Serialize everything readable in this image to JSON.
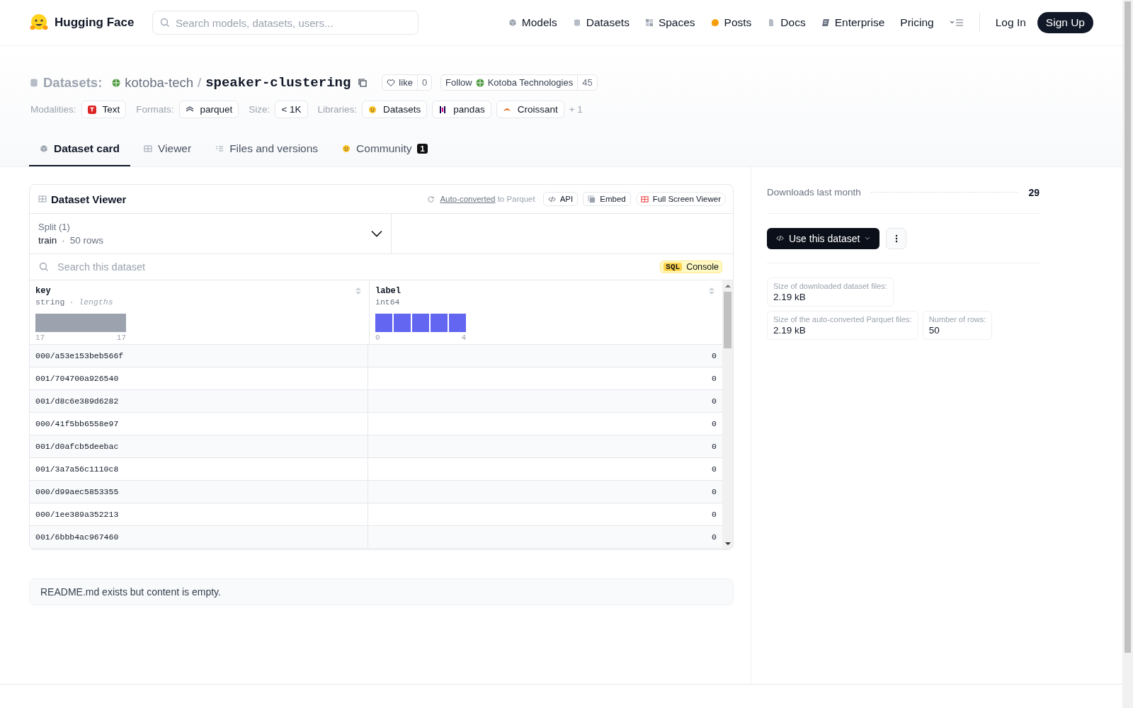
{
  "header": {
    "brand": "Hugging Face",
    "search": {
      "placeholder": "Search models, datasets, users..."
    },
    "nav": [
      {
        "label": "Models"
      },
      {
        "label": "Datasets"
      },
      {
        "label": "Spaces"
      },
      {
        "label": "Posts"
      },
      {
        "label": "Docs"
      },
      {
        "label": "Enterprise"
      },
      {
        "label": "Pricing"
      }
    ],
    "login": "Log In",
    "signup": "Sign Up"
  },
  "repo": {
    "type": "Datasets:",
    "owner": "kotoba-tech",
    "separator": "/",
    "name": "speaker-clustering",
    "like": "like",
    "likes": "0",
    "follow": "Follow",
    "org": "Kotoba Technologies",
    "followers": "45"
  },
  "tags": [
    {
      "label": "Modalities:",
      "items": [
        {
          "text": "Text"
        }
      ]
    },
    {
      "label": "Formats:",
      "items": [
        {
          "text": "parquet"
        }
      ]
    },
    {
      "label": "Size:",
      "items": [
        {
          "text": "< 1K"
        }
      ]
    },
    {
      "label": "Libraries:",
      "items": [
        {
          "text": "Datasets"
        },
        {
          "text": "pandas"
        },
        {
          "text": "Croissant"
        }
      ]
    }
  ],
  "more_tags": "+ 1",
  "tabs": [
    {
      "label": "Dataset card",
      "selected": true
    },
    {
      "label": "Viewer",
      "selected": false
    },
    {
      "label": "Files and versions",
      "selected": false
    },
    {
      "label": "Community",
      "selected": false,
      "badge": "1"
    }
  ],
  "viewer": {
    "title": "Dataset Viewer",
    "converted_link": "Auto-converted",
    "converted_rest": "to Parquet",
    "api": "API",
    "embed": "Embed",
    "fullscreen": "Full Screen Viewer",
    "split": {
      "label": "Split (1)",
      "name": "train",
      "sep": "·",
      "rows": "50 rows"
    },
    "search": {
      "placeholder": "Search this dataset"
    },
    "sql": "SQL",
    "console": "Console",
    "columns": [
      {
        "name": "key",
        "type": "string",
        "extra": "· lengths",
        "min": "17",
        "max": "17",
        "kind": "strings"
      },
      {
        "name": "label",
        "type": "int64",
        "min": "0",
        "max": "4",
        "kind": "ints"
      }
    ],
    "rows": [
      [
        "000/a53e153beb566f",
        "0"
      ],
      [
        "001/704700a926540",
        "0"
      ],
      [
        "001/d8c6e389d6282",
        "0"
      ],
      [
        "000/41f5bb6558e97",
        "0"
      ],
      [
        "001/d0afcb5deebac",
        "0"
      ],
      [
        "001/3a7a56c1110c8",
        "0"
      ],
      [
        "000/d99aec5853355",
        "0"
      ],
      [
        "000/1ee389a352213",
        "0"
      ],
      [
        "001/6bbb4ac967460",
        "0"
      ]
    ]
  },
  "readme": "README.md exists but content is empty.",
  "sidebar": {
    "downloads_label": "Downloads last month",
    "downloads": "29",
    "use": "Use this dataset",
    "stats": [
      {
        "label": "Size of downloaded dataset files:",
        "value": "2.19 kB"
      },
      {
        "label": "Size of the auto-converted Parquet files:",
        "value": "2.19 kB"
      },
      {
        "label": "Number of rows:",
        "value": "50"
      }
    ]
  }
}
